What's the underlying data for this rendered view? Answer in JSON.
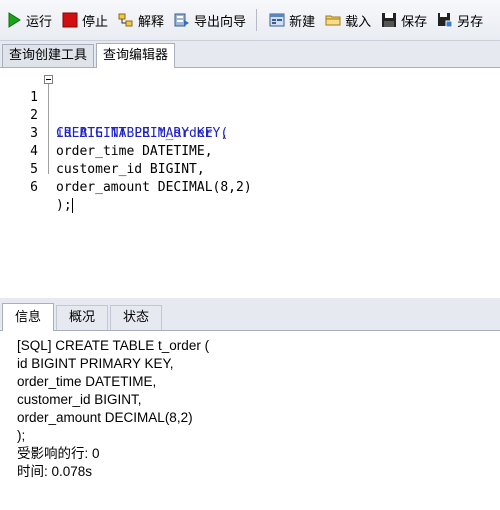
{
  "toolbar": {
    "run": "运行",
    "stop": "停止",
    "explain": "解释",
    "export_wizard": "导出向导",
    "new": "新建",
    "load": "载入",
    "save": "保存",
    "save_as": "另存"
  },
  "query_tabs": [
    "查询创建工具",
    "查询编辑器"
  ],
  "editor": {
    "lines": [
      {
        "n": "1",
        "text": "CREATE TABLE t_order ("
      },
      {
        "n": "2",
        "text": "id BIGINT PRIMARY KEY,"
      },
      {
        "n": "3",
        "text": "order_time DATETIME,"
      },
      {
        "n": "4",
        "text": "customer_id BIGINT,"
      },
      {
        "n": "5",
        "text": "order_amount DECIMAL(8,2)"
      },
      {
        "n": "6",
        "text": ");"
      }
    ]
  },
  "result_tabs": [
    "信息",
    "概况",
    "状态"
  ],
  "output": {
    "lines": [
      "[SQL] CREATE TABLE t_order (",
      "id BIGINT PRIMARY KEY,",
      "order_time DATETIME,",
      "customer_id BIGINT,",
      "order_amount DECIMAL(8,2)",
      ");",
      "受影响的行: 0",
      "时间: 0.078s"
    ]
  },
  "colors": {
    "keyword": "#1f22c7",
    "run_icon": "#1aa31a",
    "stop_icon": "#d01010"
  }
}
